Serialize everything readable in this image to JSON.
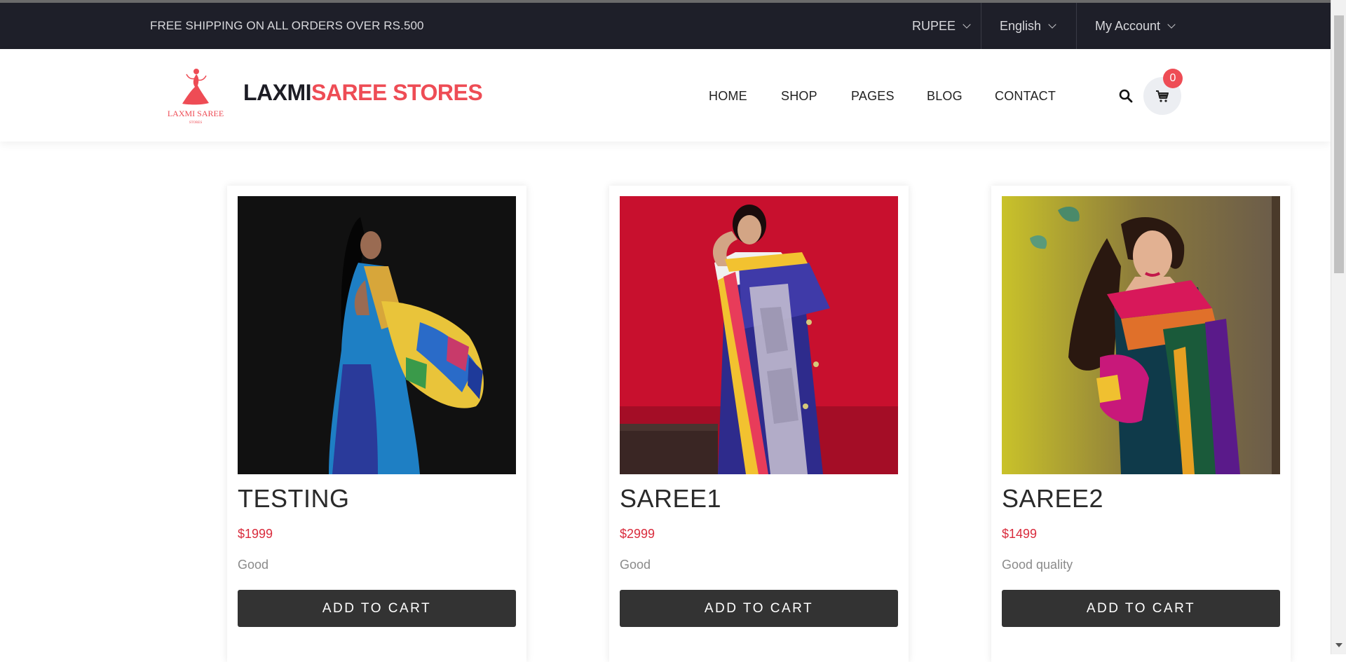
{
  "topbar": {
    "shipping_text": "FREE SHIPPING ON ALL ORDERS OVER RS.500",
    "currency": "RUPEE",
    "language": "English",
    "account": "My Account"
  },
  "header": {
    "brand_part1": "LAXMI",
    "brand_part2": "SAREE STORES",
    "logo_text": "LAXMI SAREE",
    "logo_subtext": "STORES",
    "nav": [
      "HOME",
      "SHOP",
      "PAGES",
      "BLOG",
      "CONTACT"
    ],
    "cart_count": "0"
  },
  "products": [
    {
      "title": "TESTING",
      "price": "$1999",
      "description": "Good",
      "button": "ADD TO CART"
    },
    {
      "title": "SAREE1",
      "price": "$2999",
      "description": "Good",
      "button": "ADD TO CART"
    },
    {
      "title": "SAREE2",
      "price": "$1499",
      "description": "Good quality",
      "button": "ADD TO CART"
    }
  ],
  "colors": {
    "topbar_bg": "#1e1f29",
    "brand_accent": "#ee4c55",
    "price": "#d92b3c",
    "button_bg": "#333333"
  }
}
